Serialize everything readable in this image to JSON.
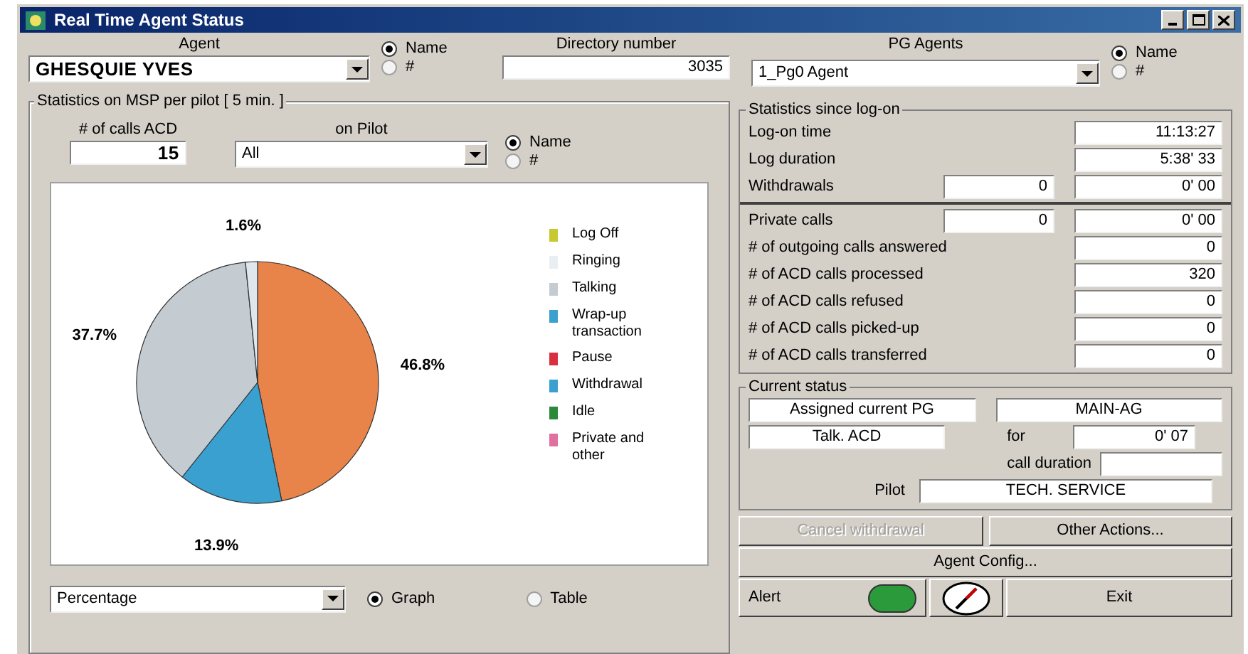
{
  "window": {
    "title": "Real Time Agent Status"
  },
  "agent": {
    "label": "Agent",
    "value": "GHESQUIE YVES",
    "radios": [
      {
        "label": "Name",
        "selected": true
      },
      {
        "label": "#",
        "selected": false
      }
    ]
  },
  "directory": {
    "label": "Directory number",
    "value": "3035"
  },
  "pg_agents": {
    "label": "PG Agents",
    "value": "1_Pg0 Agent",
    "radios": [
      {
        "label": "Name",
        "selected": true
      },
      {
        "label": "#",
        "selected": false
      }
    ]
  },
  "msp": {
    "title": "Statistics on MSP per pilot [ 5 min. ]",
    "calls_label": "# of calls ACD",
    "calls_value": "15",
    "pilot_label": "on Pilot",
    "pilot_value": "All",
    "radios": [
      {
        "label": "Name",
        "selected": true
      },
      {
        "label": "#",
        "selected": false
      }
    ],
    "chart_data": {
      "type": "pie",
      "values": [
        46.8,
        13.9,
        37.7,
        1.6
      ],
      "value_labels": [
        "46.8%",
        "13.9%",
        "37.7%",
        "1.6%"
      ]
    },
    "legend": [
      {
        "label": "Log Off",
        "color": "#c8c830"
      },
      {
        "label": "Ringing",
        "color": "#e8eef2"
      },
      {
        "label": "Talking",
        "color": "#c4ccd2"
      },
      {
        "label": "Wrap-up transaction",
        "color": "#3aa0d0"
      },
      {
        "label": "Pause",
        "color": "#d83040"
      },
      {
        "label": "Withdrawal",
        "color": "#3aa0d0"
      },
      {
        "label": "Idle",
        "color": "#2a8a3a"
      },
      {
        "label": "Private and other",
        "color": "#e070a0"
      }
    ],
    "display_value": "Percentage",
    "view_radios": [
      {
        "label": "Graph",
        "selected": true
      },
      {
        "label": "Table",
        "selected": false
      }
    ]
  },
  "since": {
    "title": "Statistics since log-on",
    "rows": [
      {
        "label": "Log-on time",
        "value": "11:13:27"
      },
      {
        "label": "Log duration",
        "value": "5:38' 33"
      },
      {
        "label": "Withdrawals",
        "count": "0",
        "value": "0' 00"
      },
      {
        "label": "Private calls",
        "count": "0",
        "value": "0' 00"
      },
      {
        "label": "# of outgoing calls answered",
        "value": "0"
      },
      {
        "label": "# of ACD calls processed",
        "value": "320"
      },
      {
        "label": "# of ACD calls refused",
        "value": "0"
      },
      {
        "label": "# of ACD calls picked-up",
        "value": "0"
      },
      {
        "label": "# of ACD calls transferred",
        "value": "0"
      }
    ]
  },
  "current": {
    "title": "Current status",
    "pg_label": "Assigned current PG",
    "pg_value": "MAIN-AG",
    "state": "Talk. ACD",
    "for_label": "for",
    "for_value": "0' 07",
    "duration_label": "call duration",
    "pilot_label": "Pilot",
    "pilot_value": "TECH. SERVICE"
  },
  "buttons": [
    {
      "label": "Cancel withdrawal",
      "disabled": true
    },
    {
      "label": "Other Actions...",
      "disabled": false
    }
  ],
  "config_button": "Agent Config...",
  "alert": {
    "label": "Alert",
    "on": true
  },
  "exit_button": "Exit"
}
